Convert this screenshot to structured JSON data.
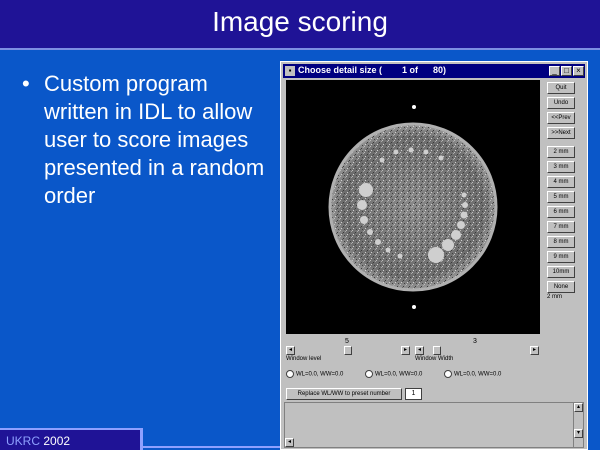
{
  "slide": {
    "title": "Image scoring",
    "bullet_symbol": "•",
    "bullet_text": "Custom program written in IDL to allow user to score images presented in a random order",
    "footer_org": "UKRC",
    "footer_year": " 2002"
  },
  "window": {
    "title": "Choose detail size (        1 of      80)",
    "system_menu_icon": "system-menu-icon",
    "buttons": [
      {
        "name": "quit-button",
        "label": "Quit"
      },
      {
        "name": "undo-button",
        "label": "Undo"
      },
      {
        "name": "previous-button",
        "label": "<<Prev"
      },
      {
        "name": "next-button",
        "label": ">>Next"
      },
      {
        "name": "size-2mm-button",
        "label": "2 mm"
      },
      {
        "name": "size-3mm-button",
        "label": "3 mm"
      },
      {
        "name": "size-4mm-button",
        "label": "4 mm"
      },
      {
        "name": "size-5mm-button",
        "label": "5 mm"
      },
      {
        "name": "size-6mm-button",
        "label": "6 mm"
      },
      {
        "name": "size-7mm-button",
        "label": "7 mm"
      },
      {
        "name": "size-8mm-button",
        "label": "8 mm"
      },
      {
        "name": "size-9mm-button",
        "label": "9 mm"
      },
      {
        "name": "size-10mm-button",
        "label": "10mm"
      },
      {
        "name": "none-button",
        "label": "None"
      }
    ],
    "size_label": "2 mm",
    "window_level": {
      "label": "Window level",
      "value": "5"
    },
    "window_width": {
      "label": "Window Width",
      "value": "3"
    },
    "presets": [
      "WL=0.0, WW=0.0",
      "WL=0.0, WW=0.0",
      "WL=0.0, WW=0.0"
    ],
    "replace_button": "Replace WL/WW to preset number",
    "preset_number": "1"
  }
}
